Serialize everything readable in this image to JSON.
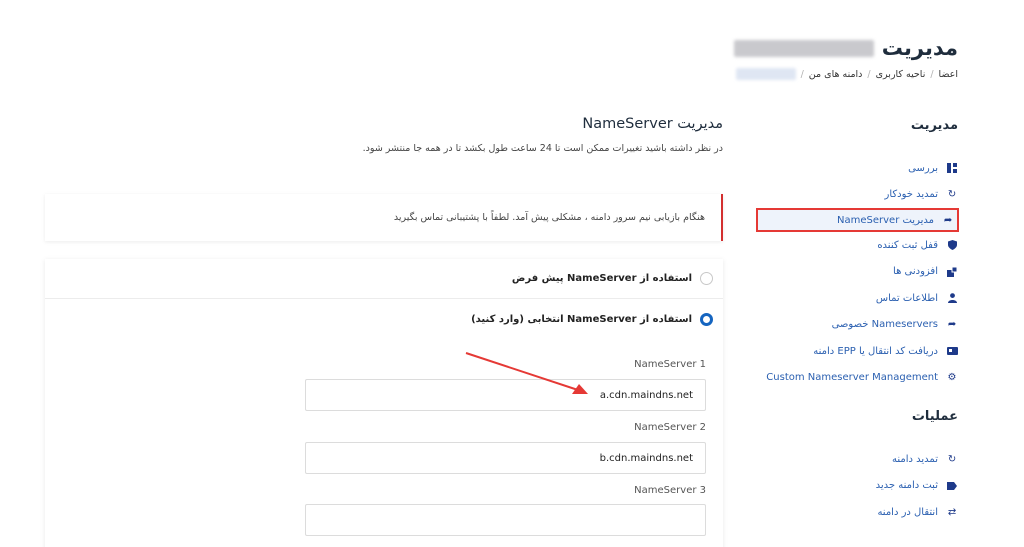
{
  "header": {
    "title": "مدیریت",
    "breadcrumb": [
      "اعضا",
      "ناحیه کاربری",
      "دامنه های من"
    ]
  },
  "sidebar": {
    "manage_title": "مدیریت",
    "manage_items": [
      {
        "label": "بررسی",
        "icon": "grid-icon"
      },
      {
        "label": "تمدید خودکار",
        "icon": "refresh-icon"
      },
      {
        "label": "مدیریت NameServer",
        "icon": "share-arrow-icon",
        "active": true
      },
      {
        "label": "قفل ثبت کننده",
        "icon": "shield-icon"
      },
      {
        "label": "افزودنی ها",
        "icon": "cubes-icon"
      },
      {
        "label": "اطلاعات تماس",
        "icon": "user-icon"
      },
      {
        "label": "Nameservers خصوصی",
        "icon": "share-arrow-icon"
      },
      {
        "label": "دریافت کد انتقال یا EPP دامنه",
        "icon": "card-icon"
      },
      {
        "label": "Custom Nameserver Management",
        "icon": "gear-icon"
      }
    ],
    "ops_title": "عملیات",
    "ops_items": [
      {
        "label": "تمدید دامنه",
        "icon": "refresh-icon"
      },
      {
        "label": "ثبت دامنه جدید",
        "icon": "tag-icon"
      },
      {
        "label": "انتقال در دامنه",
        "icon": "exchange-icon"
      }
    ]
  },
  "main": {
    "title": "مدیریت NameServer",
    "note": "در نظر داشته باشید تغییرات ممکن است تا 24 ساعت طول بکشد تا در همه جا منتشر شود.",
    "alert": "هنگام بازیابی نیم سرور دامنه ، مشکلی پیش آمد. لطفاً با پشتیبانی تماس بگیرید",
    "option_default": "استفاده از NameServer پیش فرض",
    "option_custom": "استفاده از NameServer انتخابی (وارد کنید)",
    "ns1_label": "NameServer 1",
    "ns1_value": "a.cdn.maindns.net",
    "ns2_label": "NameServer 2",
    "ns2_value": "b.cdn.maindns.net",
    "ns3_label": "NameServer 3",
    "ns3_value": ""
  },
  "colors": {
    "accent": "#1565c0",
    "link": "#2a5fb0",
    "highlight": "#e53935"
  }
}
